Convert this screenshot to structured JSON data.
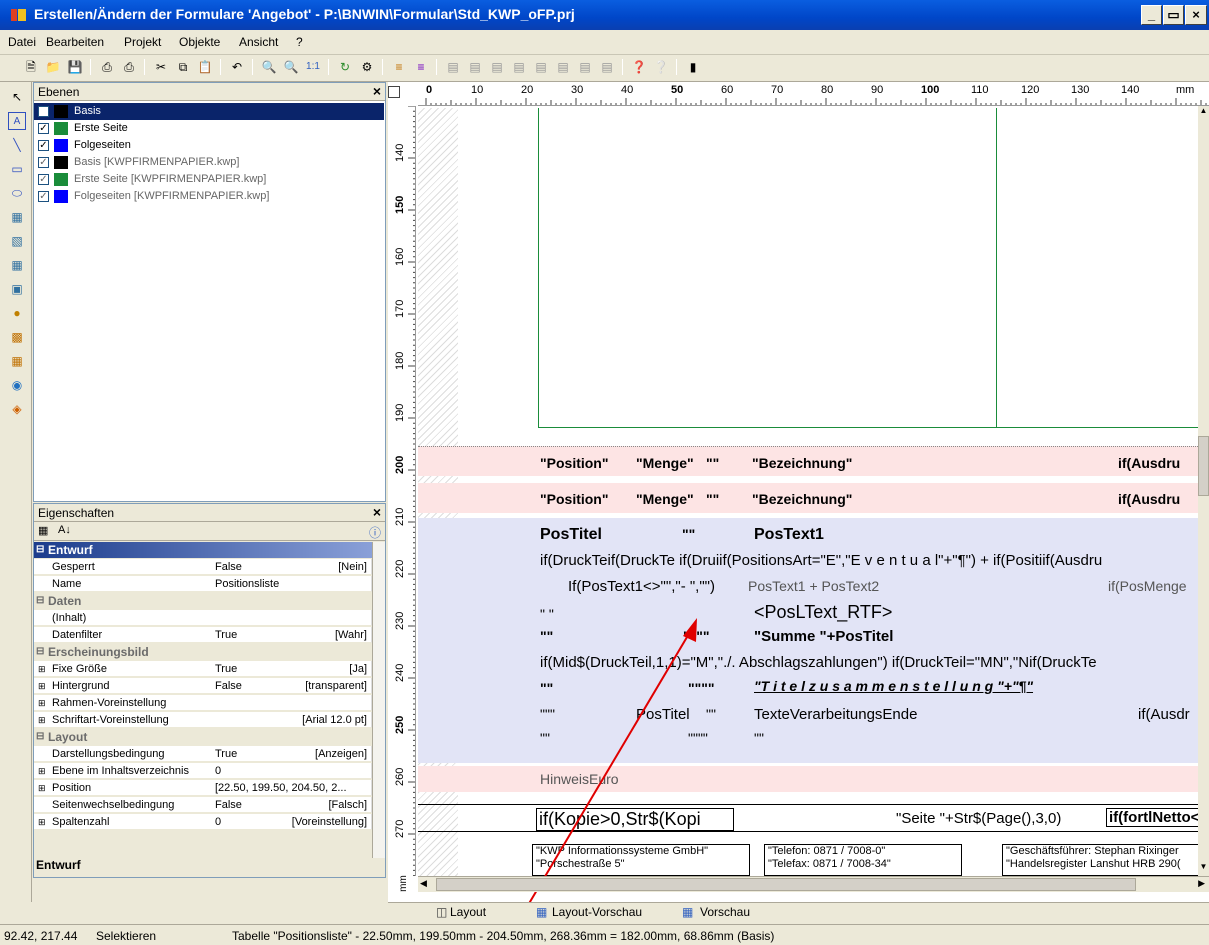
{
  "window": {
    "title": "Erstellen/Ändern der Formulare 'Angebot' - P:\\BNWIN\\Formular\\Std_KWP_oFP.prj"
  },
  "menu": [
    "Datei",
    "Bearbeiten",
    "Projekt",
    "Objekte",
    "Ansicht",
    "?"
  ],
  "layers_panel": {
    "title": "Ebenen",
    "items": [
      {
        "label": "Basis",
        "color": "#000000",
        "selected": true
      },
      {
        "label": "Erste Seite",
        "color": "#1a8c3a"
      },
      {
        "label": "Folgeseiten",
        "color": "#0000ff"
      },
      {
        "label": "Basis [KWPFIRMENPAPIER.kwp]",
        "color": "#000000"
      },
      {
        "label": "Erste Seite [KWPFIRMENPAPIER.kwp]",
        "color": "#1a8c3a"
      },
      {
        "label": "Folgeseiten [KWPFIRMENPAPIER.kwp]",
        "color": "#0000ff"
      }
    ]
  },
  "props_panel": {
    "title": "Eigenschaften",
    "footer": "Entwurf",
    "rows": [
      {
        "cat": "Entwurf",
        "active": true
      },
      {
        "n": "Gesperrt",
        "v": "False",
        "d": "[Nein]"
      },
      {
        "n": "Name",
        "v": "Positionsliste",
        "d": ""
      },
      {
        "cat": "Daten"
      },
      {
        "n": "(Inhalt)",
        "v": "",
        "d": ""
      },
      {
        "n": "Datenfilter",
        "v": "True",
        "d": "[Wahr]"
      },
      {
        "cat": "Erscheinungsbild"
      },
      {
        "n": "Fixe Größe",
        "v": "True",
        "d": "[Ja]",
        "plus": true
      },
      {
        "n": "Hintergrund",
        "v": "False",
        "d": "[transparent]",
        "plus": true
      },
      {
        "n": "Rahmen-Voreinstellung",
        "v": "",
        "d": "",
        "plus": true
      },
      {
        "n": "Schriftart-Voreinstellung",
        "v": "",
        "d": "[Arial 12.0 pt]",
        "plus": true
      },
      {
        "cat": "Layout"
      },
      {
        "n": "Darstellungsbedingung",
        "v": "True",
        "d": "[Anzeigen]"
      },
      {
        "n": "Ebene im Inhaltsverzeichnis",
        "v": "0",
        "d": "",
        "plus": true
      },
      {
        "n": "Position",
        "v": "[22.50, 199.50, 204.50, 2...",
        "d": "",
        "plus": true
      },
      {
        "n": "Seitenwechselbedingung",
        "v": "False",
        "d": "[Falsch]"
      },
      {
        "n": "Spaltenzahl",
        "v": "0",
        "d": "[Voreinstellung]",
        "plus": true
      }
    ]
  },
  "ruler": {
    "top": [
      "0",
      "10",
      "20",
      "30",
      "40",
      "50",
      "60",
      "70",
      "80",
      "90",
      "100",
      "110",
      "120",
      "130",
      "140",
      "mm"
    ],
    "left": [
      "140",
      "150",
      "160",
      "170",
      "180",
      "190",
      "200",
      "210",
      "220",
      "230",
      "240",
      "250",
      "260",
      "270"
    ],
    "corner": "mm"
  },
  "design": {
    "hdr1": [
      "\"Position\"",
      "\"Menge\"",
      "\"\"",
      "\"Bezeichnung\"",
      "if(Ausdru"
    ],
    "hdr2": [
      "\"Position\"",
      "\"Menge\"",
      "\"\"",
      "\"Bezeichnung\"",
      "if(Ausdru"
    ],
    "pos_titel": "PosTitel",
    "q1": "\"\"",
    "pos_text1": "PosText1",
    "line_if": "if(DruckTeif(DruckTe if(Druiif(PositionsArt=\"E\",\"E v e n t u a l\"+\"¶\") + if(Positiif(Ausdru",
    "line_if2": "If(PosText1<>\"\",\"-  \",\"\")",
    "pos_text_sum": "PosText1 + PosText2",
    "pos_menge": "if(PosMenge",
    "q_space": "\" \"",
    "pos_ltext": "<PosLText_RTF>",
    "q2": "\"\"",
    "q3": "\"\"\"\"",
    "summe": "\"Summe \"+PosTitel",
    "line_mid": "if(Mid$(DruckTeil,1,1)=\"M\",\"./. Abschlagszahlungen\") if(DruckTeil=\"MN\",\"Nif(DruckTe",
    "q4": "\"\"",
    "q5": "\"\"\"\"",
    "titelzus": "\"T i t e l z u s a m m e n s t e l l u n g \"+\"¶\"",
    "q6": "\"\"\"",
    "pos_titel2": "PosTitel",
    "q7": "\"\"",
    "texte_end": "TexteVerarbeitungsEnde",
    "ausdr": "if(Ausdr",
    "q8": "\"\"",
    "q9": "\"\"\"\"",
    "q10": "\"\"",
    "hinweis": "HinweisEuro",
    "kopie": "if(Kopie>0,Str$(Kopi",
    "seite": "\"Seite \"+Str$(Page(),3,0)",
    "fortl": "if(fortlNetto<",
    "f1": "\"KWP Informationssysteme GmbH\"",
    "f2": "\"Porschestraße 5\"",
    "f3": "\"Telefon: 0871 / 7008-0\"",
    "f4": "\"Telefax: 0871 / 7008-34\"",
    "f5": "\"Geschäftsführer: Stephan Rixinger",
    "f6": "\"Handelsregister Lanshut HRB 290("
  },
  "tabs": [
    "Layout",
    "Layout-Vorschau",
    "Vorschau"
  ],
  "status": {
    "coords": "92.42, 217.44",
    "mode": "Selektieren",
    "info": "Tabelle \"Positionsliste\" - 22.50mm, 199.50mm - 204.50mm, 268.36mm = 182.00mm, 68.86mm (Basis)"
  }
}
